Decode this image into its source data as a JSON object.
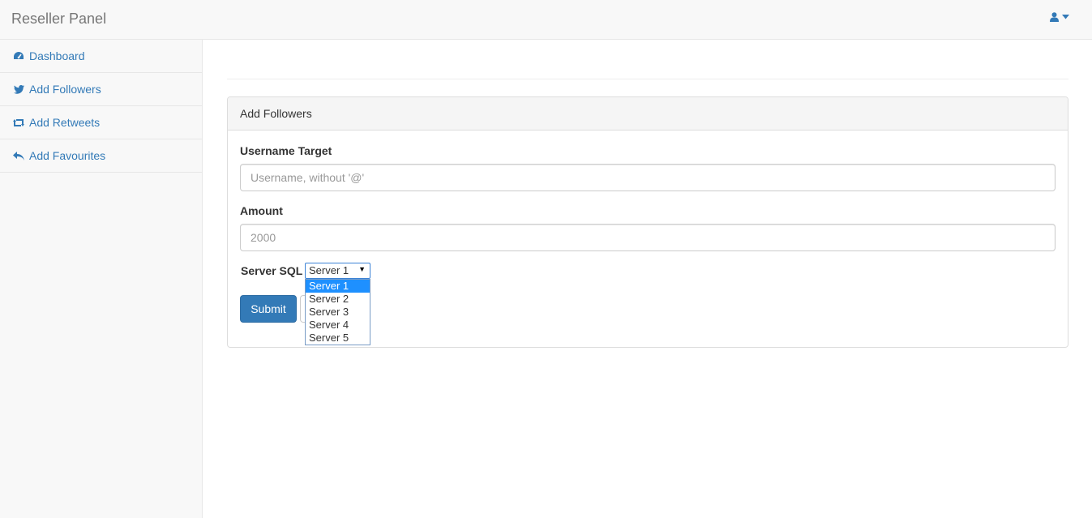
{
  "navbar": {
    "brand": "Reseller Panel",
    "user_icon": "user-icon",
    "caret_icon": "caret-down-icon"
  },
  "sidebar": {
    "items": [
      {
        "label": "Dashboard",
        "icon": "dashboard-icon"
      },
      {
        "label": "Add Followers",
        "icon": "twitter-icon"
      },
      {
        "label": "Add Retweets",
        "icon": "retweet-icon"
      },
      {
        "label": "Add Favourites",
        "icon": "reply-icon"
      }
    ]
  },
  "panel": {
    "heading": "Add Followers",
    "username": {
      "label": "Username Target",
      "placeholder": "Username, without '@'",
      "value": ""
    },
    "amount": {
      "label": "Amount",
      "placeholder": "2000",
      "value": ""
    },
    "server": {
      "label": "Server SQL",
      "selected": "Server 1",
      "options": [
        "Server 1",
        "Server 2",
        "Server 3",
        "Server 4",
        "Server 5"
      ]
    },
    "submit_label": "Submit"
  },
  "colors": {
    "link": "#337ab7",
    "primary_button": "#337ab7",
    "selected_option": "#1e90ff"
  }
}
